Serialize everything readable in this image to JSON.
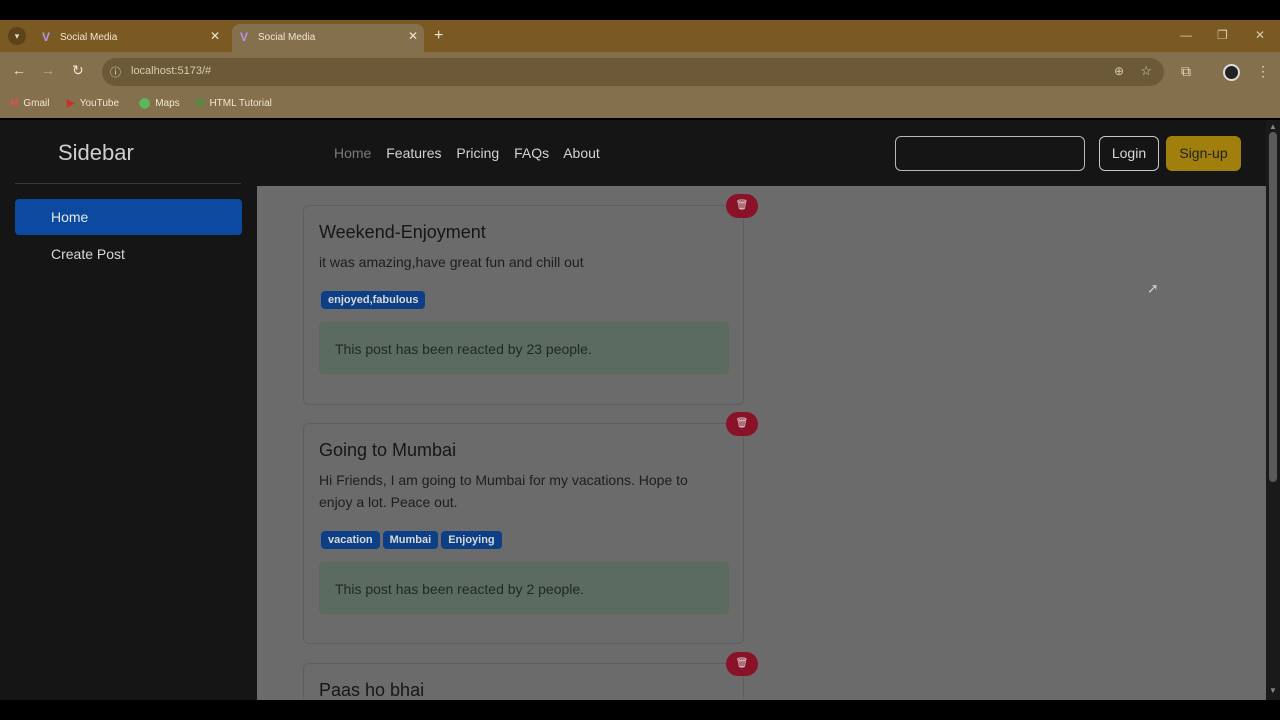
{
  "browser": {
    "tabs": [
      {
        "title": "Social Media",
        "active": false
      },
      {
        "title": "Social Media",
        "active": true
      }
    ],
    "url": "localhost:5173/#",
    "bookmarks": [
      {
        "label": "Gmail",
        "icon": "gmail-icon"
      },
      {
        "label": "YouTube",
        "icon": "youtube-icon"
      },
      {
        "label": "Maps",
        "icon": "maps-icon"
      },
      {
        "label": "HTML Tutorial",
        "icon": "w3schools-icon"
      }
    ]
  },
  "sidebar": {
    "brand": "Sidebar",
    "items": [
      {
        "label": "Home",
        "active": true
      },
      {
        "label": "Create Post",
        "active": false
      }
    ]
  },
  "header": {
    "nav": [
      "Home",
      "Features",
      "Pricing",
      "FAQs",
      "About"
    ],
    "search_value": "",
    "login_label": "Login",
    "signup_label": "Sign-up"
  },
  "posts": [
    {
      "title": "Weekend-Enjoyment",
      "body": "it was amazing,have great fun and chill out",
      "tags": [
        "enjoyed,fabulous"
      ],
      "reaction": "This post has been reacted by 23 people."
    },
    {
      "title": "Going to Mumbai",
      "body": "Hi Friends, I am going to Mumbai for my vacations. Hope to enjoy a lot. Peace out.",
      "tags": [
        "vacation",
        "Mumbai",
        "Enjoying"
      ],
      "reaction": "This post has been reacted by 2 people."
    },
    {
      "title": "Paas ho bhai",
      "body": "",
      "tags": [],
      "reaction": ""
    }
  ],
  "colors": {
    "accent_blue": "#0d6efd",
    "signup_yellow": "#ffc107",
    "delete_red": "#dc3545"
  }
}
